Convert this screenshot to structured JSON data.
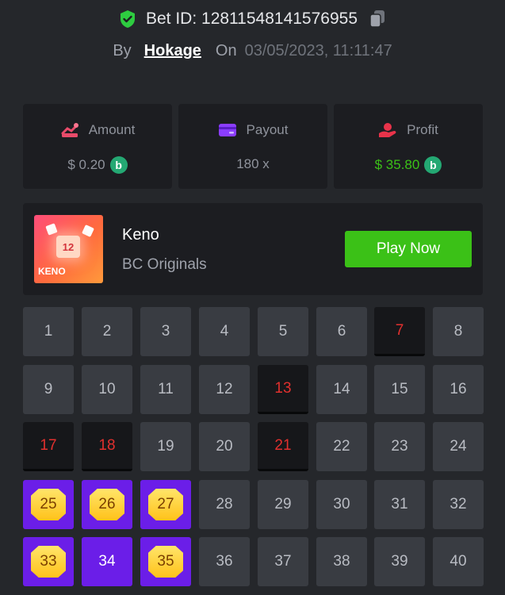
{
  "header": {
    "bet_id": "Bet ID: 12811548141576955",
    "by_label": "By",
    "username": "Hokage",
    "on_label": "On",
    "datetime": "03/05/2023, 11:11:47"
  },
  "stats": {
    "amount": {
      "label": "Amount",
      "value": "$ 0.20"
    },
    "payout": {
      "label": "Payout",
      "value": "180 x"
    },
    "profit": {
      "label": "Profit",
      "value": "$ 35.80"
    }
  },
  "game": {
    "name": "Keno",
    "provider": "BC Originals",
    "thumb_text": "KENO",
    "thumb_number": "12",
    "play_label": "Play Now"
  },
  "colors": {
    "accent_green": "#3bc117",
    "pick_purple": "#6b1ee8",
    "miss_red": "#e1302e"
  },
  "board": {
    "tiles": [
      {
        "n": "1",
        "state": "default"
      },
      {
        "n": "2",
        "state": "default"
      },
      {
        "n": "3",
        "state": "default"
      },
      {
        "n": "4",
        "state": "default"
      },
      {
        "n": "5",
        "state": "default"
      },
      {
        "n": "6",
        "state": "default"
      },
      {
        "n": "7",
        "state": "miss"
      },
      {
        "n": "8",
        "state": "default"
      },
      {
        "n": "9",
        "state": "default"
      },
      {
        "n": "10",
        "state": "default"
      },
      {
        "n": "11",
        "state": "default"
      },
      {
        "n": "12",
        "state": "default"
      },
      {
        "n": "13",
        "state": "miss"
      },
      {
        "n": "14",
        "state": "default"
      },
      {
        "n": "15",
        "state": "default"
      },
      {
        "n": "16",
        "state": "default"
      },
      {
        "n": "17",
        "state": "miss"
      },
      {
        "n": "18",
        "state": "miss"
      },
      {
        "n": "19",
        "state": "default"
      },
      {
        "n": "20",
        "state": "default"
      },
      {
        "n": "21",
        "state": "miss"
      },
      {
        "n": "22",
        "state": "default"
      },
      {
        "n": "23",
        "state": "default"
      },
      {
        "n": "24",
        "state": "default"
      },
      {
        "n": "25",
        "state": "hit"
      },
      {
        "n": "26",
        "state": "hit"
      },
      {
        "n": "27",
        "state": "hit"
      },
      {
        "n": "28",
        "state": "default"
      },
      {
        "n": "29",
        "state": "default"
      },
      {
        "n": "30",
        "state": "default"
      },
      {
        "n": "31",
        "state": "default"
      },
      {
        "n": "32",
        "state": "default"
      },
      {
        "n": "33",
        "state": "hit"
      },
      {
        "n": "34",
        "state": "pick"
      },
      {
        "n": "35",
        "state": "hit"
      },
      {
        "n": "36",
        "state": "default"
      },
      {
        "n": "37",
        "state": "default"
      },
      {
        "n": "38",
        "state": "default"
      },
      {
        "n": "39",
        "state": "default"
      },
      {
        "n": "40",
        "state": "default"
      }
    ]
  }
}
